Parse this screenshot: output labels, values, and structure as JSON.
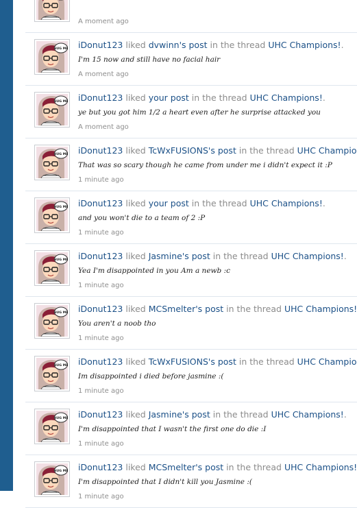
{
  "colors": {
    "sidebar": "#1f5e8f",
    "link": "#1b5087",
    "meta_text": "#8b8b8b",
    "divider": "#dfe6ee"
  },
  "avatar_badge_text": "HUG ME",
  "feed": [
    {
      "user": "",
      "liked": "",
      "target": "",
      "in_thread": "",
      "thread": "",
      "excerpt": "",
      "time": "A moment ago"
    },
    {
      "user": "iDonut123",
      "liked": "liked",
      "target": "dvwinn's post",
      "in_thread": "in the thread",
      "thread": "UHC Champions!",
      "excerpt": "I'm 15 now and still have no facial hair",
      "time": "A moment ago"
    },
    {
      "user": "iDonut123",
      "liked": "liked",
      "target": "your post",
      "in_thread": "in the thread",
      "thread": "UHC Champions!",
      "excerpt": "ye but you got him 1/2 a heart even after he surprise attacked you",
      "time": "A moment ago"
    },
    {
      "user": "iDonut123",
      "liked": "liked",
      "target": "TcWxFUSIONS's post",
      "in_thread": "in the thread",
      "thread": "UHC Champions!",
      "excerpt": "That was so scary though he came from under me i didn't expect it :P",
      "time": "1 minute ago"
    },
    {
      "user": "iDonut123",
      "liked": "liked",
      "target": "your post",
      "in_thread": "in the thread",
      "thread": "UHC Champions!",
      "excerpt": "and you won't die to a team of 2 :P",
      "time": "1 minute ago"
    },
    {
      "user": "iDonut123",
      "liked": "liked",
      "target": "Jasmine's post",
      "in_thread": "in the thread",
      "thread": "UHC Champions!",
      "excerpt": "Yea I'm disappointed in you Am a newb :c",
      "time": "1 minute ago"
    },
    {
      "user": "iDonut123",
      "liked": "liked",
      "target": "MCSmelter's post",
      "in_thread": "in the thread",
      "thread": "UHC Champions!",
      "excerpt": "You aren't a noob tho",
      "time": "1 minute ago"
    },
    {
      "user": "iDonut123",
      "liked": "liked",
      "target": "TcWxFUSIONS's post",
      "in_thread": "in the thread",
      "thread": "UHC Champions!",
      "excerpt": "Im disappointed i died before jasmine :(",
      "time": "1 minute ago"
    },
    {
      "user": "iDonut123",
      "liked": "liked",
      "target": "Jasmine's post",
      "in_thread": "in the thread",
      "thread": "UHC Champions!",
      "excerpt": "I'm disappointed that I wasn't the first one do die :I",
      "time": "1 minute ago"
    },
    {
      "user": "iDonut123",
      "liked": "liked",
      "target": "MCSmelter's post",
      "in_thread": "in the thread",
      "thread": "UHC Champions!",
      "excerpt": "I'm disappointed that I didn't kill you Jasmine :(",
      "time": "1 minute ago"
    }
  ]
}
